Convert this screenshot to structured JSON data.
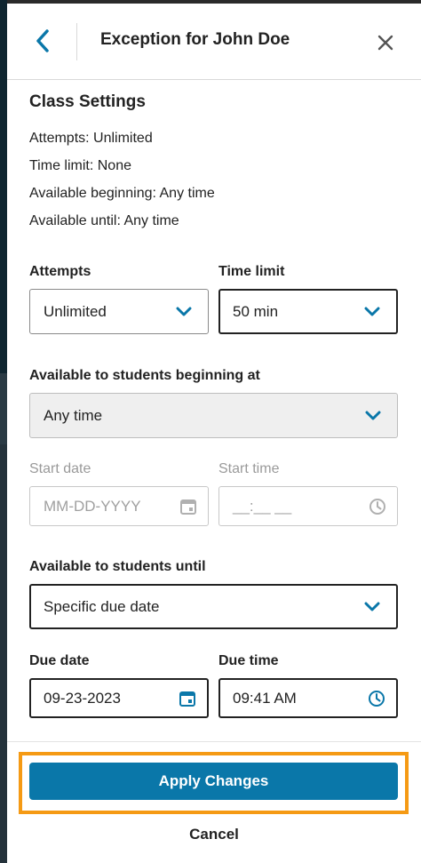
{
  "header": {
    "title": "Exception for John Doe",
    "back_icon": "chevron-left-icon",
    "close_icon": "close-icon"
  },
  "class_settings": {
    "title": "Class Settings",
    "lines": [
      "Attempts: Unlimited",
      "Time limit: None",
      "Available beginning: Any time",
      "Available until: Any time"
    ]
  },
  "form": {
    "attempts": {
      "label": "Attempts",
      "value": "Unlimited"
    },
    "time_limit": {
      "label": "Time limit",
      "value": "50 min"
    },
    "available_beginning": {
      "label": "Available to students beginning at",
      "value": "Any time"
    },
    "start_date": {
      "label": "Start date",
      "placeholder": "MM-DD-YYYY"
    },
    "start_time": {
      "label": "Start time",
      "placeholder": "__:__ __"
    },
    "available_until": {
      "label": "Available to students until",
      "value": "Specific due date"
    },
    "due_date": {
      "label": "Due date",
      "value": "09-23-2023"
    },
    "due_time": {
      "label": "Due time",
      "value": "09:41 AM"
    }
  },
  "footer": {
    "apply_label": "Apply Changes",
    "cancel_label": "Cancel"
  },
  "colors": {
    "accent": "#0a77a9",
    "highlight": "#f59a14",
    "disabled_text": "#9a9a9a"
  }
}
